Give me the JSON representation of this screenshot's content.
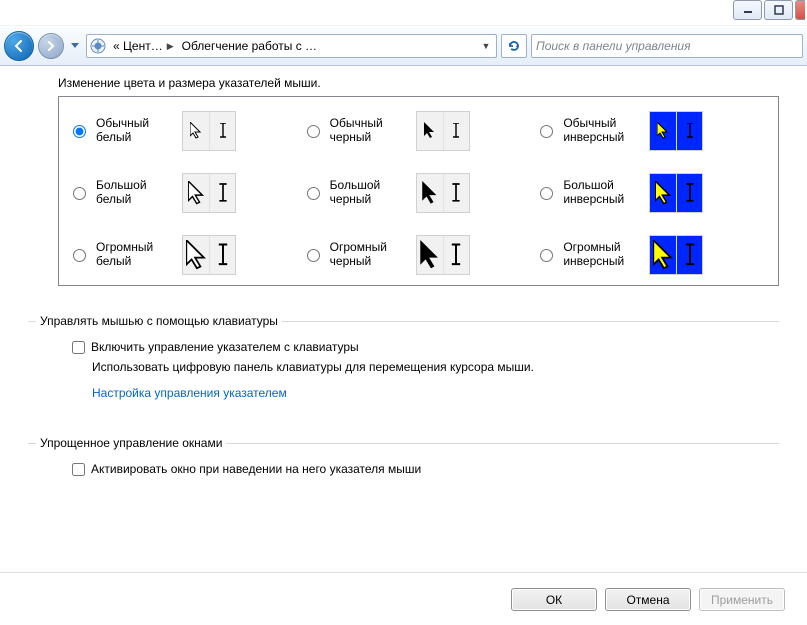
{
  "window": {
    "minimize": "–",
    "maximize": "□",
    "close": "×"
  },
  "nav": {
    "crumb_root_prefix": "«",
    "crumb_root": "Цент…",
    "crumb_current": "Облегчение работы с …",
    "search_placeholder": "Поиск в панели управления"
  },
  "heading": "Изменение цвета и размера указателей мыши.",
  "cursors": {
    "o1": {
      "line1": "Обычный",
      "line2": "белый"
    },
    "o2": {
      "line1": "Обычный",
      "line2": "черный"
    },
    "o3": {
      "line1": "Обычный",
      "line2": "инверсный"
    },
    "o4": {
      "line1": "Большой",
      "line2": "белый"
    },
    "o5": {
      "line1": "Большой",
      "line2": "черный"
    },
    "o6": {
      "line1": "Большой",
      "line2": "инверсный"
    },
    "o7": {
      "line1": "Огромный",
      "line2": "белый"
    },
    "o8": {
      "line1": "Огромный",
      "line2": "черный"
    },
    "o9": {
      "line1": "Огромный",
      "line2": "инверсный"
    }
  },
  "keyboard_mouse": {
    "legend": "Управлять мышью с помощью клавиатуры",
    "checkbox": "Включить управление указателем с клавиатуры",
    "desc": "Использовать цифровую панель клавиатуры для перемещения курсора мыши.",
    "link": "Настройка управления указателем"
  },
  "windows_mgmt": {
    "legend": "Упрощенное управление окнами",
    "checkbox": "Активировать окно при наведении на него указателя мыши"
  },
  "buttons": {
    "ok": "ОК",
    "cancel": "Отмена",
    "apply": "Применить"
  }
}
